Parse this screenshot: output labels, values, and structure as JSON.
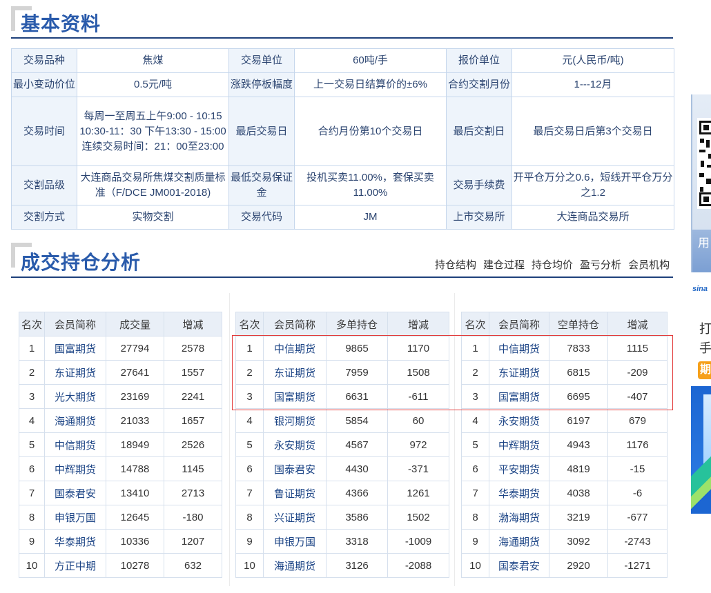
{
  "colors": {
    "heading_blue": "#2a5bab",
    "rule_navy": "#1d3f7a",
    "label_bg": "#eef4fb",
    "table_border": "#c6d7ec",
    "text": "#2b4470",
    "member_link": "#1d4586",
    "highlight_red": "#e23b3b"
  },
  "basic_info": {
    "title": "基本资料",
    "rows": [
      [
        {
          "label": "交易品种",
          "value": "焦煤"
        },
        {
          "label": "交易单位",
          "value": "60吨/手"
        },
        {
          "label": "报价单位",
          "value": "元(人民币/吨)"
        }
      ],
      [
        {
          "label": "最小变动价位",
          "value": "0.5元/吨"
        },
        {
          "label": "涨跌停板幅度",
          "value": "上一交易日结算价的±6%"
        },
        {
          "label": "合约交割月份",
          "value": "1---12月"
        }
      ],
      [
        {
          "label": "交易时间",
          "value": "每周一至周五上午9:00 - 10:15 10:30-11：30 下午13:30 - 15:00 连续交易时间：21：00至23:00"
        },
        {
          "label": "最后交易日",
          "value": "合约月份第10个交易日"
        },
        {
          "label": "最后交割日",
          "value": "最后交易日后第3个交易日"
        }
      ],
      [
        {
          "label": "交割品级",
          "value": "大连商品交易所焦煤交割质量标准（F/DCE JM001-2018)"
        },
        {
          "label": "最低交易保证金",
          "value": "投机买卖11.00%，套保买卖11.00%"
        },
        {
          "label": "交易手续费",
          "value": "开平仓万分之0.6，短线开平仓万分之1.2"
        }
      ],
      [
        {
          "label": "交割方式",
          "value": "实物交割"
        },
        {
          "label": "交易代码",
          "value": "JM"
        },
        {
          "label": "上市交易所",
          "value": "大连商品交易所"
        }
      ]
    ]
  },
  "analysis": {
    "title": "成交持仓分析",
    "nav": [
      "持仓结构",
      "建仓过程",
      "持仓均价",
      "盈亏分析",
      "会员机构"
    ],
    "tables": [
      {
        "headers": [
          "名次",
          "会员简称",
          "成交量",
          "增减"
        ],
        "rows": [
          {
            "rank": 1,
            "member": "国富期货",
            "value": 27794,
            "change": 2578
          },
          {
            "rank": 2,
            "member": "东证期货",
            "value": 27641,
            "change": 1557
          },
          {
            "rank": 3,
            "member": "光大期货",
            "value": 23169,
            "change": 2241
          },
          {
            "rank": 4,
            "member": "海通期货",
            "value": 21033,
            "change": 1657
          },
          {
            "rank": 5,
            "member": "中信期货",
            "value": 18949,
            "change": 2526
          },
          {
            "rank": 6,
            "member": "中辉期货",
            "value": 14788,
            "change": 1145
          },
          {
            "rank": 7,
            "member": "国泰君安",
            "value": 13410,
            "change": 2713
          },
          {
            "rank": 8,
            "member": "申银万国",
            "value": 12645,
            "change": -180
          },
          {
            "rank": 9,
            "member": "华泰期货",
            "value": 10336,
            "change": 1207
          },
          {
            "rank": 10,
            "member": "方正中期",
            "value": 10278,
            "change": 632
          }
        ]
      },
      {
        "headers": [
          "名次",
          "会员简称",
          "多单持仓",
          "增减"
        ],
        "rows": [
          {
            "rank": 1,
            "member": "中信期货",
            "value": 9865,
            "change": 1170
          },
          {
            "rank": 2,
            "member": "东证期货",
            "value": 7959,
            "change": 1508
          },
          {
            "rank": 3,
            "member": "国富期货",
            "value": 6631,
            "change": -611
          },
          {
            "rank": 4,
            "member": "银河期货",
            "value": 5854,
            "change": 60
          },
          {
            "rank": 5,
            "member": "永安期货",
            "value": 4567,
            "change": 972
          },
          {
            "rank": 6,
            "member": "国泰君安",
            "value": 4430,
            "change": -371
          },
          {
            "rank": 7,
            "member": "鲁证期货",
            "value": 4366,
            "change": 1261
          },
          {
            "rank": 8,
            "member": "兴证期货",
            "value": 3586,
            "change": 1502
          },
          {
            "rank": 9,
            "member": "申银万国",
            "value": 3318,
            "change": -1009
          },
          {
            "rank": 10,
            "member": "海通期货",
            "value": 3126,
            "change": -2088
          }
        ]
      },
      {
        "headers": [
          "名次",
          "会员简称",
          "空单持仓",
          "增减"
        ],
        "rows": [
          {
            "rank": 1,
            "member": "中信期货",
            "value": 7833,
            "change": 1115
          },
          {
            "rank": 2,
            "member": "东证期货",
            "value": 6815,
            "change": -209
          },
          {
            "rank": 3,
            "member": "国富期货",
            "value": 6695,
            "change": -407
          },
          {
            "rank": 4,
            "member": "永安期货",
            "value": 6197,
            "change": 679
          },
          {
            "rank": 5,
            "member": "中辉期货",
            "value": 4943,
            "change": 1176
          },
          {
            "rank": 6,
            "member": "平安期货",
            "value": 4819,
            "change": -15
          },
          {
            "rank": 7,
            "member": "华泰期货",
            "value": 4038,
            "change": -6
          },
          {
            "rank": 8,
            "member": "渤海期货",
            "value": 3219,
            "change": -677
          },
          {
            "rank": 9,
            "member": "海通期货",
            "value": 3092,
            "change": -2743
          },
          {
            "rank": 10,
            "member": "国泰君安",
            "value": 2920,
            "change": -1271
          }
        ]
      }
    ]
  },
  "ads": {
    "qr_banner": {
      "text": "用"
    },
    "sina_banner": {
      "logo": "sina",
      "line1": "打",
      "line2": "手",
      "badge": "期"
    }
  }
}
